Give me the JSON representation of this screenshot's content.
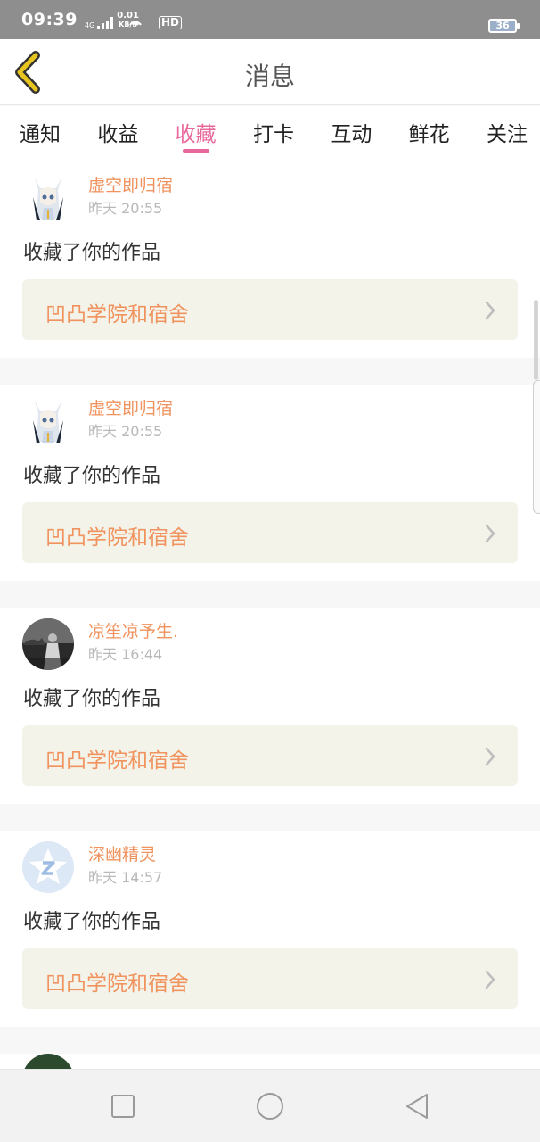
{
  "status_bar": {
    "time": "09:39",
    "network_small_top": "4G",
    "network_small_bottom": "HD",
    "speed_value": "0.01",
    "speed_unit": "KB/S",
    "hd_label": "HD",
    "battery": "36"
  },
  "header": {
    "title": "消息",
    "back_icon": "chevron-left-icon"
  },
  "tabs": [
    {
      "label": "通知",
      "active": false
    },
    {
      "label": "收益",
      "active": false
    },
    {
      "label": "收藏",
      "active": true
    },
    {
      "label": "打卡",
      "active": false
    },
    {
      "label": "互动",
      "active": false
    },
    {
      "label": "鲜花",
      "active": false
    },
    {
      "label": "关注",
      "active": false
    }
  ],
  "messages": [
    {
      "username": "虚空即归宿",
      "time": "昨天 20:55",
      "action": "收藏了你的作品",
      "work_title": "凹凸学院和宿舍"
    },
    {
      "username": "虚空即归宿",
      "time": "昨天 20:55",
      "action": "收藏了你的作品",
      "work_title": "凹凸学院和宿舍"
    },
    {
      "username": "凉笙凉予生.",
      "time": "昨天 16:44",
      "action": "收藏了你的作品",
      "work_title": "凹凸学院和宿舍"
    },
    {
      "username": "深幽精灵",
      "time": "昨天 14:57",
      "action": "收藏了你的作品",
      "work_title": "凹凸学院和宿舍"
    }
  ],
  "colors": {
    "accent_pink": "#e8689c",
    "username_orange": "#f0935e",
    "back_yellow": "#e8c41e"
  },
  "navbar": {
    "icons": [
      "recent-apps-square-icon",
      "home-circle-icon",
      "back-triangle-icon"
    ]
  }
}
